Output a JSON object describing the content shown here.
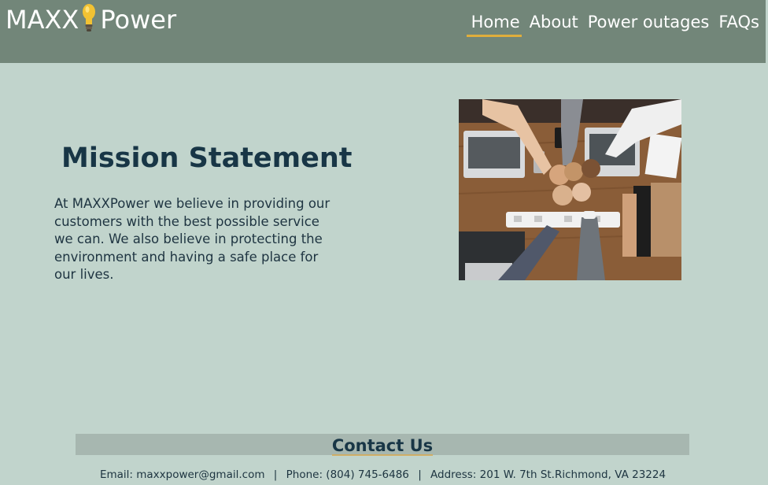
{
  "header": {
    "logo_left": "MAXX",
    "logo_right": "Power",
    "logo_icon": "lightbulb-icon",
    "nav": [
      {
        "label": "Home",
        "active": true
      },
      {
        "label": "About",
        "active": false
      },
      {
        "label": "Power outages",
        "active": false
      },
      {
        "label": "FAQs",
        "active": false
      }
    ]
  },
  "main": {
    "title": "Mission Statement",
    "text": "At MAXXPower we believe in providing our customers with the best possible service we can. We also believe in protecting the environment and having a safe place for our lives.",
    "image_subject": "team fist bump over desk with laptops"
  },
  "footer": {
    "title": "Contact Us",
    "email": "Email: maxxpower@gmail.com",
    "phone": "Phone: (804) 745-6486",
    "address": "Address: 201 W. 7th St.Richmond, VA 23224",
    "separator": "|"
  },
  "colors": {
    "header_bg": "#728679",
    "page_bg": "#c1d4cc",
    "accent": "#e0ae3c",
    "heading": "#183646",
    "contact_bar": "#a7b7b0"
  }
}
